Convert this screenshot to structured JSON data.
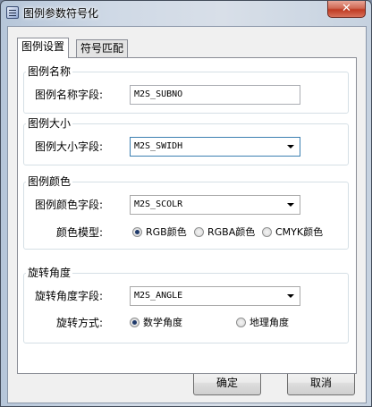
{
  "window": {
    "title": "图例参数符号化",
    "close_glyph": "✕"
  },
  "tabs": [
    {
      "label": "图例设置",
      "active": true
    },
    {
      "label": "符号匹配",
      "active": false
    }
  ],
  "groups": {
    "name": {
      "title": "图例名称",
      "field_label": "图例名称字段:",
      "field_value": "M2S_SUBNO"
    },
    "size": {
      "title": "图例大小",
      "field_label": "图例大小字段:",
      "field_value": "M2S_SWIDH"
    },
    "color": {
      "title": "图例颜色",
      "field_label": "图例颜色字段:",
      "field_value": "M2S_SCOLR",
      "model_label": "颜色模型:",
      "models": [
        {
          "label": "RGB颜色",
          "selected": true
        },
        {
          "label": "RGBA颜色",
          "selected": false
        },
        {
          "label": "CMYK颜色",
          "selected": false
        }
      ]
    },
    "rotation": {
      "title": "旋转角度",
      "field_label": "旋转角度字段:",
      "field_value": "M2S_ANGLE",
      "mode_label": "旋转方式:",
      "modes": [
        {
          "label": "数学角度",
          "selected": true
        },
        {
          "label": "地理角度",
          "selected": false
        }
      ]
    }
  },
  "buttons": {
    "ok": "确定",
    "cancel": "取消"
  },
  "colors": {
    "window_frame": "#434c5a",
    "close_button": "#c44a33",
    "selected_radio": "#1f3a6b"
  }
}
